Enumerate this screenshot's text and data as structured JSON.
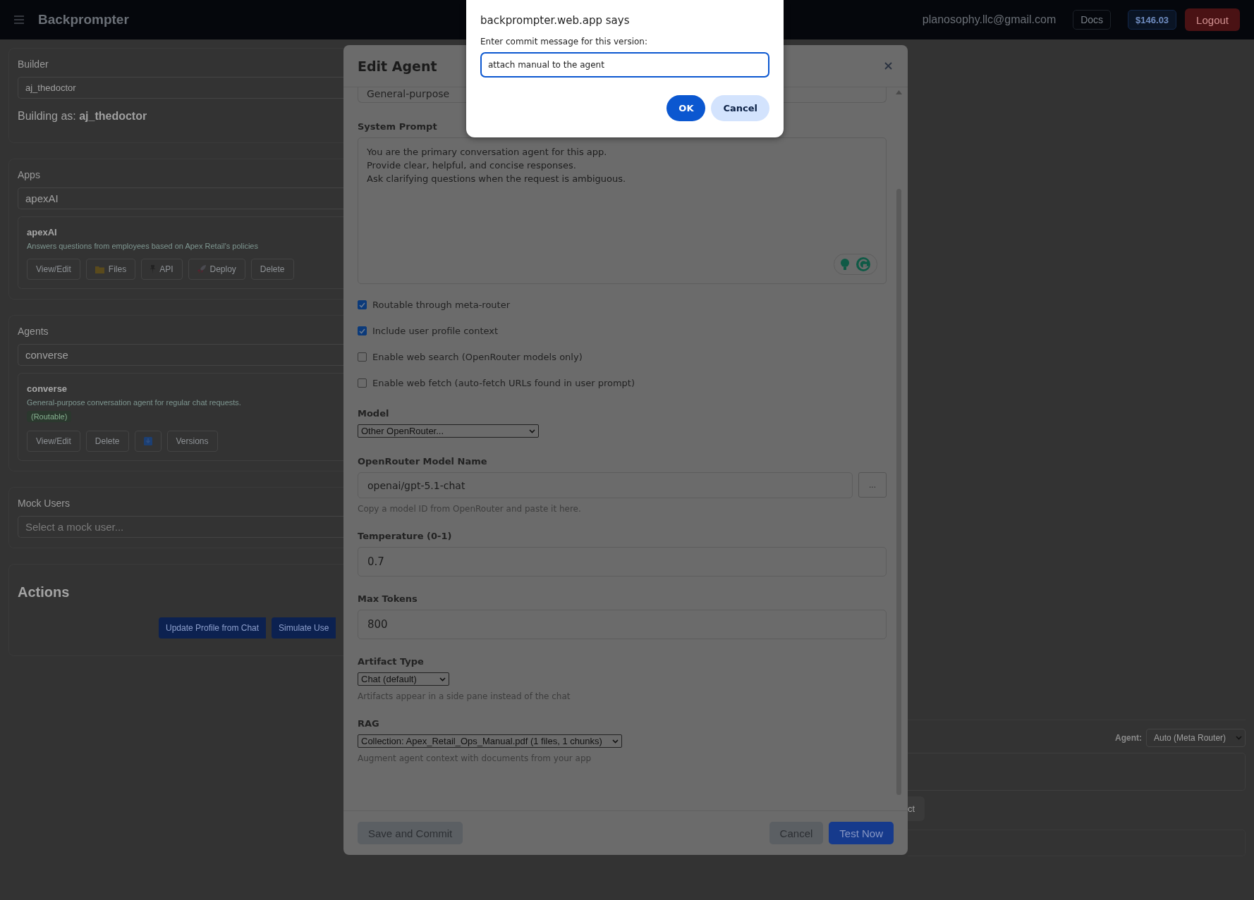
{
  "top_bar": {
    "brand": "Backprompter",
    "email": "planosophy.llc@gmail.com",
    "docs": "Docs",
    "balance": "$146.03",
    "logout": "Logout"
  },
  "builder": {
    "title": "Builder",
    "select": "aj_thedoctor",
    "building_as": "Building as: **aj_thedoctor**"
  },
  "apps": {
    "title": "Apps",
    "select": "apexAI",
    "item": {
      "name": "apexAI",
      "description": "Answers questions from employees based on Apex Retail's policies",
      "buttons": [
        {
          "kind": "plain",
          "label": "View/Edit"
        },
        {
          "kind": "folder",
          "label": "Files"
        },
        {
          "kind": "pin",
          "label": "API"
        },
        {
          "kind": "rocket",
          "label": "Deploy"
        },
        {
          "kind": "plain",
          "label": "Delete"
        }
      ]
    }
  },
  "agents": {
    "title": "Agents",
    "select": "converse",
    "item": {
      "name": "converse",
      "description": "General-purpose conversation agent for regular chat requests.",
      "badge": "(Routable)",
      "buttons": [
        {
          "kind": "plain",
          "label": "View/Edit"
        },
        {
          "kind": "plain",
          "label": "Delete"
        },
        {
          "kind": "download"
        },
        {
          "kind": "plain",
          "label": "Versions"
        }
      ]
    }
  },
  "mock_users": {
    "title": "Mock Users",
    "select": {
      "placeholder": "Select a mock user..."
    }
  },
  "actions": {
    "title": "Actions",
    "buttons": [
      "Update Profile from Chat",
      "Simulate Use"
    ]
  },
  "chat": {
    "button_fragment": "ct",
    "agent_label": "Agent:",
    "agent_select": "Auto (Meta Router)"
  },
  "edit_agent": {
    "title": "Edit Agent",
    "description_fragment": "General-purpose",
    "system_prompt_label": "System Prompt",
    "system_prompt": "You are the primary conversation agent for this app.\nProvide clear, helpful, and concise responses.\nAsk clarifying questions when the request is ambiguous.",
    "options": [
      {
        "label": "Routable through meta-router",
        "checked": true
      },
      {
        "label": "Include user profile context",
        "checked": true
      },
      {
        "label": "Enable web search (OpenRouter models only)",
        "checked": false
      },
      {
        "label": "Enable web fetch (auto-fetch URLs found in user prompt)",
        "checked": false
      }
    ],
    "model_label": "Model",
    "model": "Other OpenRouter...",
    "model_name_label": "OpenRouter Model Name",
    "model_name": "openai/gpt-5.1-chat",
    "browse": "...",
    "model_name_hint": "Copy a model ID from OpenRouter and paste it here.",
    "temperature_label": "Temperature (0-1)",
    "temperature": "0.7",
    "max_tokens_label": "Max Tokens",
    "max_tokens": "800",
    "artifact_label": "Artifact Type",
    "artifact": "Chat (default)",
    "artifact_hint": "Artifacts appear in a side pane instead of the chat",
    "rag_label": "RAG",
    "rag": "Collection: Apex_Retail_Ops_Manual.pdf (1 files, 1 chunks)",
    "rag_hint": "Augment agent context with documents from your app",
    "save": "Save and Commit",
    "cancel": "Cancel",
    "test": "Test Now"
  },
  "prompt": {
    "title": "backprompter.web.app says",
    "message": "Enter commit message for this version:",
    "value": "attach manual to the agent",
    "ok": "OK",
    "cancel": "Cancel"
  }
}
